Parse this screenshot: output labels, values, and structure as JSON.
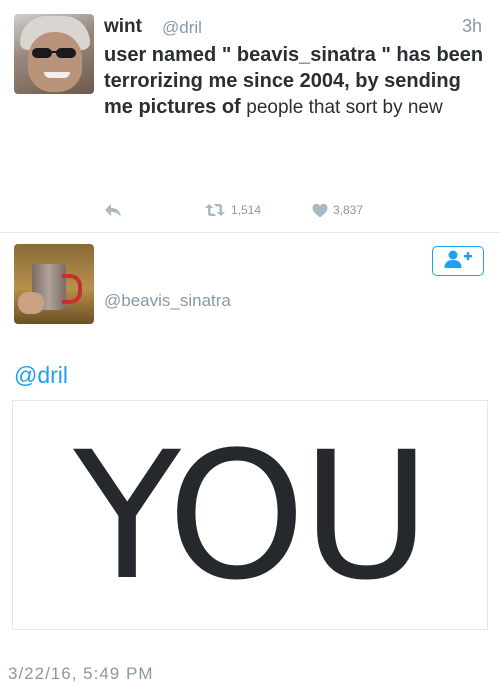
{
  "tweet": {
    "author_name": "wint",
    "author_handle": "@dril",
    "time_ago": "3h",
    "text_main": "user named \" beavis_sinatra \" has been terrorizing me since 2004, by sending me pictures of",
    "text_tail": "people that sort by new",
    "retweets": "1,514",
    "likes": "3,837",
    "icons": [
      "reply-icon",
      "retweet-icon",
      "heart-icon"
    ]
  },
  "reply": {
    "author_handle": "@beavis_sinatra",
    "follow_icon": "add-user-icon",
    "mention": "@dril",
    "media_text": "YOU",
    "timestamp": "3/22/16, 5:49 PM"
  },
  "colors": {
    "accent": "#1da1f2",
    "muted": "#8899a6",
    "text": "#292f33"
  }
}
